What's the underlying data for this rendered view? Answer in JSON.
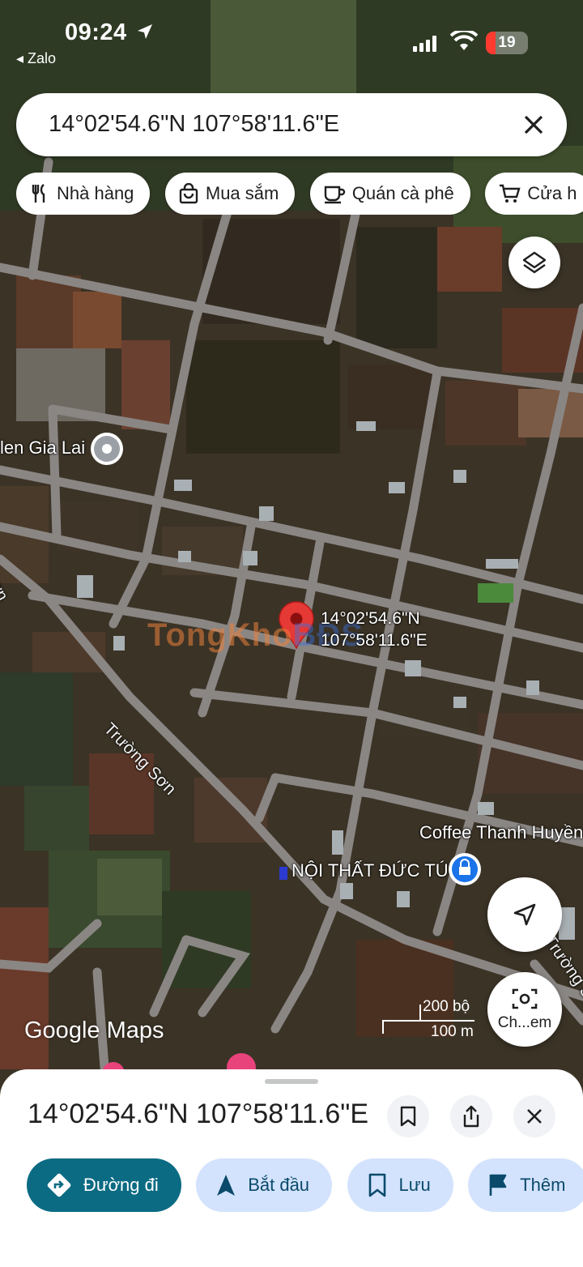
{
  "status_bar": {
    "time": "09:24",
    "back_app": "◂ Zalo",
    "battery": "19"
  },
  "search": {
    "query": "14°02'54.6\"N 107°58'11.6\"E"
  },
  "chips": [
    {
      "label": "Nhà hàng",
      "icon": "fork-knife-icon"
    },
    {
      "label": "Mua sắm",
      "icon": "shopping-bag-icon"
    },
    {
      "label": "Quán cà phê",
      "icon": "coffee-cup-icon"
    },
    {
      "label": "Cửa h",
      "icon": "cart-icon"
    }
  ],
  "map": {
    "pin_label_line1": "14°02'54.6\"N",
    "pin_label_line2": "107°58'11.6\"E",
    "places": {
      "left_place": "len Gia Lai",
      "coffee": "Coffee Thanh Huyền",
      "furniture": "NỘI THẤT ĐỨC TÚ",
      "road_main": "Trường Sơn",
      "road_edge": "Sơn",
      "road_right": "Trường S"
    },
    "watermark_a": "Tong",
    "watermark_b": "Kho",
    "watermark_c": "BĐS",
    "brand": "Google Maps",
    "scale_top": "200 bộ",
    "scale_bottom": "100 m",
    "lens_label": "Ch...em",
    "pin_color": "#e53935"
  },
  "sheet": {
    "title": "14°02'54.6\"N 107°58'11.6\"E",
    "actions": [
      {
        "label": "Đường đi",
        "icon": "directions-icon"
      },
      {
        "label": "Bắt đầu",
        "icon": "navigation-arrow-icon"
      },
      {
        "label": "Lưu",
        "icon": "bookmark-icon"
      },
      {
        "label": "Thêm",
        "icon": "flag-icon"
      }
    ]
  }
}
